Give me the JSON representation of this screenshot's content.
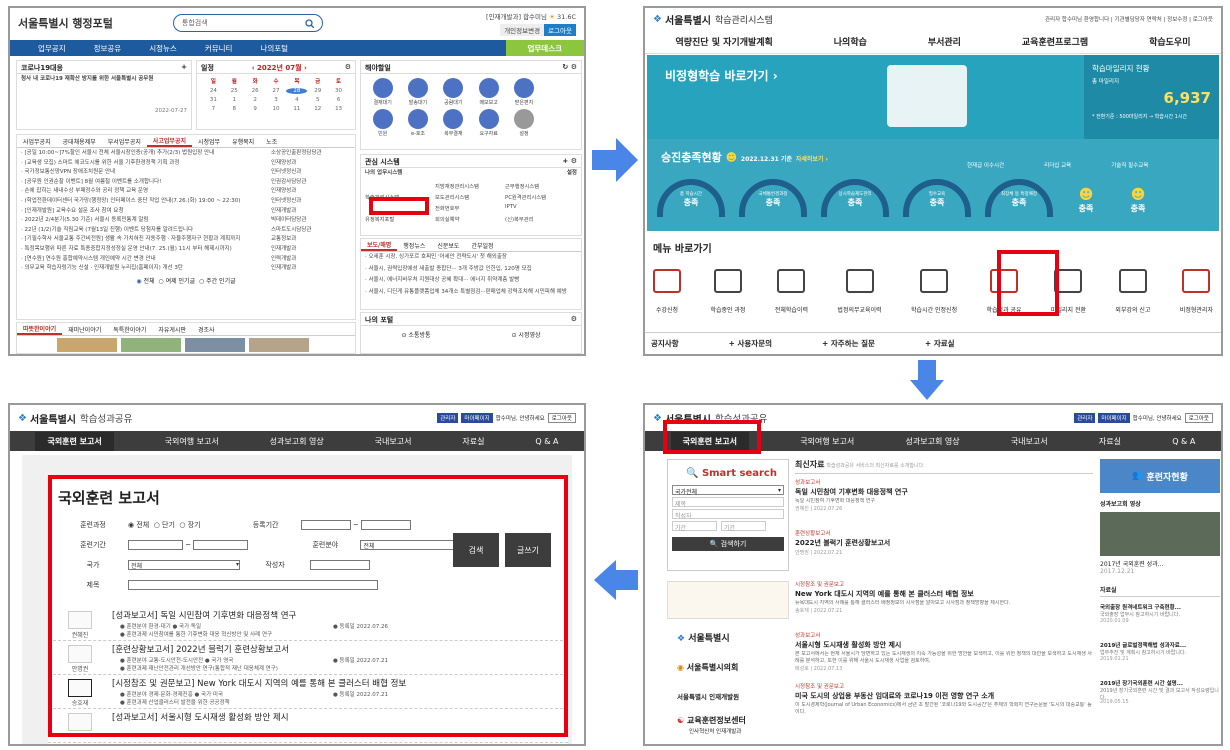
{
  "colors": {
    "flow_arrow": "#4a86e8",
    "highlight": "#e60012",
    "nav_blue": "#1e5a9e",
    "teal": "#27a3bd"
  },
  "panel1": {
    "title": "서울특별시 행정포털",
    "search_placeholder": "통합검색",
    "top_info": "[인재개발과] 합수미님",
    "weather": "31.6C",
    "btn1": "개인정보변경",
    "btn2": "로그아웃",
    "nav": [
      "업무공지",
      "정보공유",
      "시정뉴스",
      "커뮤니티",
      "나의포털"
    ],
    "mytask": "업무데스크",
    "corona_title": "코로나19대응",
    "corona_text": "청사 내 코로나19 재확산 방지를 위한 서울특별시 공무원",
    "corona_date": "2022-07-27",
    "schedule_title": "일정",
    "schedule_month": "‹ 2022년 07월 ›",
    "week": [
      "일",
      "월",
      "화",
      "수",
      "목",
      "금",
      "토"
    ],
    "days": [
      "24",
      "25",
      "26",
      "27",
      "28",
      "29",
      "30",
      "31",
      "1",
      "2",
      "3",
      "4",
      "5",
      "6",
      "7",
      "8",
      "9",
      "10",
      "11",
      "12",
      "13"
    ],
    "haeyang_title": "해야할일",
    "icons": [
      "결재대기",
      "발송대기",
      "공람대기",
      "메모보고",
      "받은편지",
      "민원",
      "e-호조",
      "복무결재",
      "요구자료",
      "설정"
    ],
    "tabs1": [
      "사업무공지",
      "공대채용제부",
      "부서업무공지",
      "사고업무공지",
      "시청업무",
      "유행복지",
      "노조"
    ],
    "notices": [
      "· [공일 10:00~]7%할인 서울시 전체 서울시장인증(공개) 추가(2/3) 법원입장 안내",
      "· (교육생 모집) 스마트 에코도시를 위한 서울 기후환경정책 기획 과정",
      "· 국가정보통신망VPN 장애조치원문 안내",
      "· [공무원 인권순찰 이벤트] 8월 여름철 이벤트를 소개합니다!",
      "· 손에 잡히는 새내수상 부패정수와 공리 정책 교육 운영",
      "· (학업전환데이터센터 국가망(행정망) 인터페이스 중단 작업 안내(7.26.(화) 19:00 ~ 22:30)",
      "· [인재개발원] 교육수요 설문 조사 참여 요청",
      "· 2022년 2/4분기(5.30 기준) 서울시 동록민통계 알림",
      "· 22년 (1/2)기술 직림교육 (7월13일 진행) 이벤트 당첨자를 알려드립니다",
      "· [기필수학사 서울교통 주간비전원] 생활 속 가치혀진 자동주행 · 자율주행자구 현황과 계획까지",
      "· 특정목보행위 따른 자료 특종중합지정성정실 운영 안내(7. 25.(월) 11시 부터 해제시까지)",
      "· [연수원] 연수원 홍합예약시스템 개인예약 시간 변경 안내",
      "· 의무교육 학습자링기능 신설 · 인재개발원 누리집(홈페이지) 개선 3탄"
    ],
    "notice_depts": [
      "소상공인출판정담당관",
      "인재양성과",
      "인터넷정신과",
      "인권감사담당관",
      "인재양성과",
      "인터넷정신과",
      "인재개발과",
      "빅데이터담당관",
      "스마트도시담당관",
      "교통정보과",
      "인재개발과",
      "인력개발과",
      "인재개발과"
    ],
    "radio": [
      "전체",
      "여제 인기글",
      "주간 인기글"
    ],
    "tabs2": [
      "따뜻한이야기",
      "재미난이야기",
      "독특한이야기",
      "자유게시판",
      "경조사"
    ],
    "gwansim_title": "관심 시스템",
    "my_systems_title": "나의 업무시스템",
    "my_systems_setting": "설정",
    "systems": [
      "학습관리시스템",
      "지방재정관리시스템",
      "근무행정시스템",
      "보도관리시스템",
      "PC원격관리시스템",
      "전화번호부",
      "IPTV",
      "유정복지포털",
      "회의실예약",
      "(신)복무관리"
    ],
    "press_tabs": [
      "보도/해명",
      "행정뉴스",
      "신문보도",
      "간부일정"
    ],
    "press": [
      "· 오세훈 시장, 싱가포르 호찌민 '어세안 전략도시' 첫 해외출장",
      "· 서울시, 권력입장에성 새출발 종합단··· 3개 주방값 인한입, 120명 모집",
      "· 서울시, 에너지바우처 지원대상 공혜 확대··· 에너지 취약계층 발빵",
      "· 서울시, 디딘게 유통플랫폼업체 34개소 특별점검···판매업체 강력조치해 시민피해 예방"
    ],
    "myportal_title": "나의 포털",
    "portal_items": [
      "소통방통",
      "시정영상"
    ],
    "more": "보기 설정"
  },
  "panel2": {
    "title": "서울특별시",
    "subtitle": "학습관리시스템",
    "links": "관리자  합수미님 환영합니다 | 기관별담당자 연락처 | 정보수정 | 로그아웃",
    "nav": [
      "역량진단 및 자기개발계획",
      "나의학습",
      "부서관리",
      "교육훈련프로그램",
      "학습도우미"
    ],
    "banner_text": "비정형학습 바로가기 ›",
    "mileage_title": "학습마일리지 현황",
    "mileage_sub": "총 마일리지",
    "mileage_value": "6,937",
    "mileage_note": "* 전환기준 : 500마일리지 → 학습시간 1시간",
    "stat_title": "승진충족현황",
    "stat_date": "2022.12.31 기준",
    "stat_more": "자세히보기 ›",
    "stat_sub": [
      "현재급 이수시간",
      "리더십 교육",
      "기술직 필수교육"
    ],
    "gauges": [
      "총 학습시간",
      "국체통번경과정",
      "상시학습제도관리",
      "필수교육",
      "최장체 등 특정예정"
    ],
    "gauge_status": "충족",
    "menu_title": "메뉴 바로가기",
    "menu_items": [
      "수강신청",
      "학습중인 과정",
      "전체학습이력",
      "법정의무교육이력",
      "학습시간 인정신청",
      "학습성과 공유",
      "마일리지 전환",
      "외부강의 신고",
      "비정형관리자"
    ],
    "footer": [
      "공지사항",
      "+  사용자문의",
      "+  자주하는 질문",
      "+  자료실"
    ]
  },
  "panel3": {
    "title": "서울특별시",
    "subtitle": "학습성과공유",
    "tag1": "관리자",
    "tag2": "마이페이지",
    "user": "합수미님, 안녕하세요",
    "logout": "로그아웃",
    "nav": [
      "국외훈련 보고서",
      "국외여행 보고서",
      "성과보고회 영상",
      "국내보고서",
      "자료실",
      "Q & A"
    ],
    "heading": "국외훈련 보고서",
    "f_course": "훈련과정",
    "radios": [
      "전체",
      "단기",
      "장기"
    ],
    "f_reg": "등록기간",
    "f_period": "훈련기간",
    "f_field": "훈련분야",
    "f_field_val": "전체",
    "f_country": "국가",
    "f_country_val": "전체",
    "f_author": "작성자",
    "f_title": "제목",
    "btn_search": "검색",
    "btn_write": "글쓰기",
    "items": [
      {
        "title": "[성과보고서] 독일 시민참여 기후변화 대응정책 연구",
        "meta": "● 훈련분야 환경-대기   ● 국가 독일",
        "meta2": "● 훈련과제 시민참여를 통한 기후변화 대응 혁신방안 및 사례 연구",
        "date": "● 등록일 2022.07.26",
        "author": "권혜진"
      },
      {
        "title": "[훈련상황보고서] 2022년 블럭기 훈련상황보고서",
        "meta": "● 훈련분야 교통-도시안전-도시안전   ● 국가 영국",
        "meta2": "● 훈련과제 재난안전관리 개선방안 연구(통합적 재난 대응체계 연구)",
        "date": "● 등록일 2022.07.21",
        "author": "안명권"
      },
      {
        "title": "[시정참조 및 권문보고] New York 대도시 지역의 예를 통해 본 클러스터 배협 정보",
        "meta": "● 훈련분야 경제·문화-경제진흥   ● 국가 미국",
        "meta2": "● 훈련과제 산업클러스터 발전을 위한 공공정책",
        "date": "● 등록일 2022.07.21",
        "author": "송호재"
      },
      {
        "title": "[성과보고서] 서울시형 도시재생 활성화 방안 제시",
        "meta": "",
        "meta2": "",
        "date": "",
        "author": ""
      }
    ]
  },
  "panel4": {
    "smart_search": "Smart search",
    "select1": "국가전체",
    "inputs": [
      "제목",
      "작성자",
      "기간",
      "기간"
    ],
    "search_btn": "검색하기",
    "latest_title": "최신자료",
    "latest_sub": "학습성과공유 서비스의 최신자료를 소개합니다.",
    "news": [
      {
        "cat": "성과보고서",
        "title": "독일 시민참여 기후변화 대응정책 연구",
        "desc": "독일 시민참여 기후변화 대응정책 연구",
        "meta": "권혜진 | 2022.07.26"
      },
      {
        "cat": "훈련상황보고서",
        "title": "2022년 블럭기 훈련상황보고서",
        "desc": "",
        "meta": "안명권 | 2022.07.21"
      },
      {
        "cat": "시정참조 및 권문보고",
        "title": "New York 대도시 지역의 예를 통해 본 클러스터 배협 정보",
        "desc": "뉴욕대도시 지역의 사례를 통해 클러스터 배정정보의 시사점을 알아보고 시사점과 정책방향을 제시한다.",
        "meta": "송호재 | 2022.07.21"
      },
      {
        "cat": "성과보고서",
        "title": "서울시형 도시재생 활성화 방안 제시",
        "desc": "본 보고서에서는 현재 서울시가 당면하고 있는 도시재생의 지속 가능성을 위한 방안을 모색하고, 이를 위한 정책의 대안을 모색하고 도시재생 사례를 분석하고, 또한 이를 위해 서울시 도시재생 사업을 검토하여,",
        "meta": "배성호 | 2022.07.13"
      },
      {
        "cat": "시정참조 및 권문보고",
        "title": "미국 도시의 상업용 부동산 임대료와 코로나19 이전 영향 연구 소개",
        "desc": "이 도시경제학(Journal of Urban Economics)에서 금년 초 발간된 '코로나19와 도시공간'은 주제의 학회지 연구논문을 '도시의 대중교통' 등 이다.",
        "meta": ""
      }
    ],
    "side_logos": [
      "서울특별시",
      "서울특별시의회",
      "서울특별시 인재개발원",
      "교육훈련정보센터"
    ],
    "side_logo_sub": "인사혁신처 인재개발과",
    "right_title": "훈련자현황",
    "video_title": "성과보고회 영상",
    "video_caption": "2017년 국외훈련 성과...",
    "video_date": "2017.12.21",
    "datasets_title": "자료실",
    "datasets": [
      {
        "t": "국외출장 원격네트워크 구축현황...",
        "d": "국외출장 업무시 참고하시기 바랍니다.",
        "date": "2020.01.09"
      },
      {
        "t": "2019년 글로벌정책해법 성과자료...",
        "d": "업무추진 및 계획시 참고하시기 바랍니다.",
        "date": "2019.01.21"
      },
      {
        "t": "2019년 장기국외훈련 시간 설명...",
        "d": "2019년 장기국외훈련 시간 및 결과 보고서 작성요령입니다.",
        "date": "2019.05.15"
      }
    ]
  }
}
